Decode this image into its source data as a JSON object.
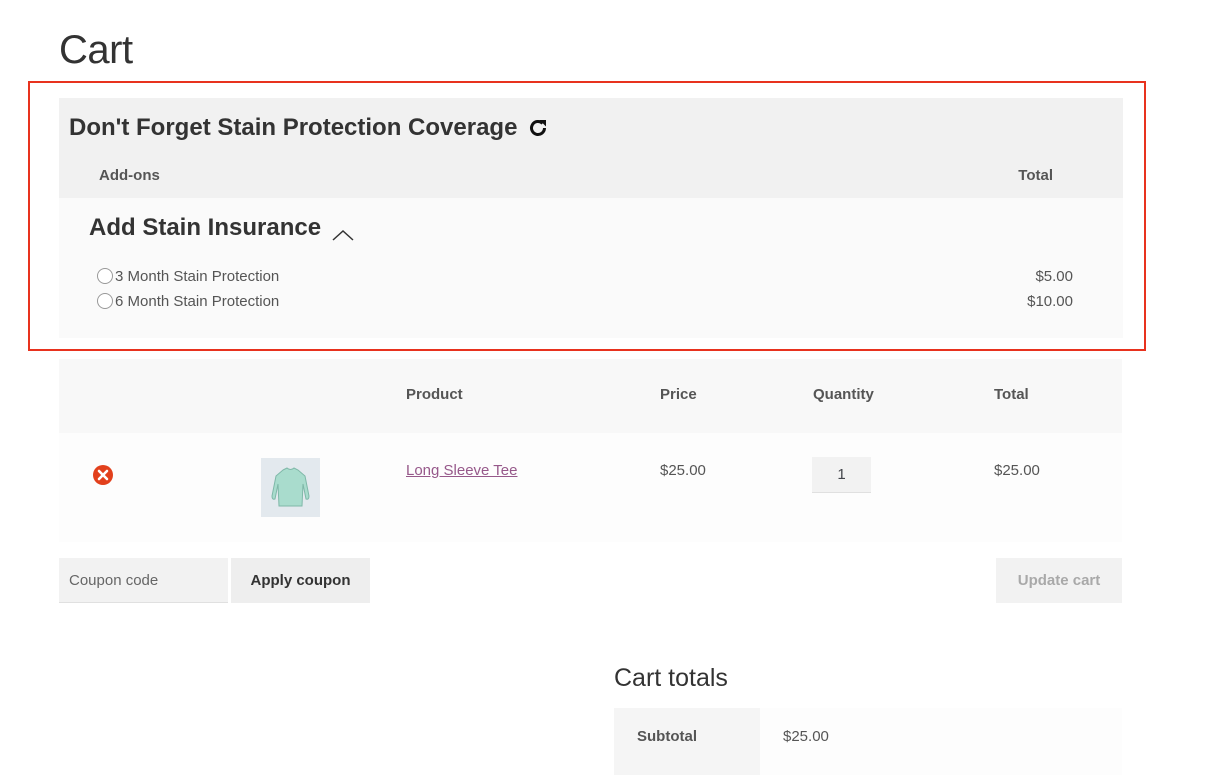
{
  "page": {
    "title": "Cart"
  },
  "addons": {
    "heading": "Don't Forget Stain Protection Coverage",
    "col_addons": "Add-ons",
    "col_total": "Total",
    "group_title": "Add Stain Insurance",
    "options": [
      {
        "label": "3 Month Stain Protection",
        "price": "$5.00"
      },
      {
        "label": "6 Month Stain Protection",
        "price": "$10.00"
      }
    ]
  },
  "cart": {
    "headers": {
      "product": "Product",
      "price": "Price",
      "quantity": "Quantity",
      "total": "Total"
    },
    "items": [
      {
        "name": "Long Sleeve Tee",
        "price": "$25.00",
        "quantity": "1",
        "total": "$25.00"
      }
    ],
    "coupon_placeholder": "Coupon code",
    "apply_coupon_label": "Apply coupon",
    "update_cart_label": "Update cart"
  },
  "totals": {
    "title": "Cart totals",
    "subtotal_label": "Subtotal",
    "subtotal_value": "$25.00"
  },
  "colors": {
    "highlight": "#e8321e",
    "link": "#96588a",
    "remove": "#e2401c"
  }
}
